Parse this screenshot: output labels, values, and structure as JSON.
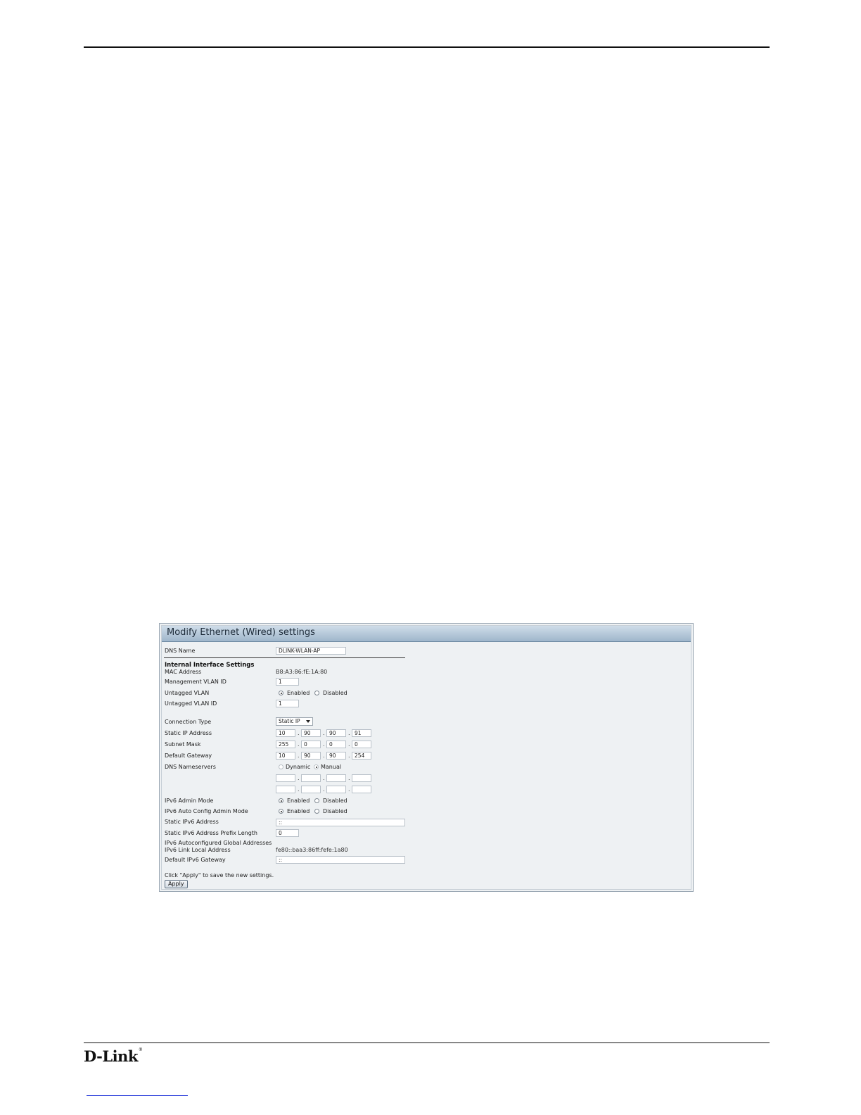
{
  "brand": {
    "name": "D-Link",
    "mark": "®"
  },
  "panel": {
    "title": "Modify Ethernet (Wired) settings",
    "dns_name": {
      "label": "DNS Name",
      "value": "DLINK-WLAN-AP"
    },
    "section_heading": "Internal Interface Settings",
    "mac": {
      "label": "MAC Address",
      "value": "B8:A3:86:fE:1A:80"
    },
    "mgmt_vlan": {
      "label": "Management VLAN ID",
      "value": "1"
    },
    "untagged_vlan": {
      "label": "Untagged VLAN",
      "option_enabled": "Enabled",
      "option_disabled": "Disabled",
      "selected": "Enabled"
    },
    "untagged_vlan_id": {
      "label": "Untagged VLAN ID",
      "value": "1"
    },
    "connection_type": {
      "label": "Connection Type",
      "value": "Static IP"
    },
    "static_ip": {
      "label": "Static IP Address",
      "octets": [
        "10",
        "90",
        "90",
        "91"
      ]
    },
    "subnet_mask": {
      "label": "Subnet Mask",
      "octets": [
        "255",
        "0",
        "0",
        "0"
      ]
    },
    "default_gateway": {
      "label": "Default Gateway",
      "octets": [
        "10",
        "90",
        "90",
        "254"
      ]
    },
    "dns_nameservers": {
      "label": "DNS Nameservers",
      "option_dynamic": "Dynamic",
      "option_manual": "Manual",
      "selected": "Manual",
      "server1": [
        "",
        "",
        "",
        ""
      ],
      "server2": [
        "",
        "",
        "",
        ""
      ]
    },
    "octet_separator": ".",
    "ipv6_admin_mode": {
      "label": "IPv6 Admin Mode",
      "option_enabled": "Enabled",
      "option_disabled": "Disabled",
      "selected": "Enabled"
    },
    "ipv6_auto_config": {
      "label": "IPv6 Auto Config Admin Mode",
      "option_enabled": "Enabled",
      "option_disabled": "Disabled",
      "selected": "Enabled"
    },
    "static_ipv6": {
      "label": "Static IPv6 Address",
      "value": "::"
    },
    "static_ipv6_prefix": {
      "label": "Static IPv6 Address Prefix Length",
      "value": "0"
    },
    "ipv6_global": {
      "label": "IPv6 Autoconfigured Global Addresses"
    },
    "ipv6_link_local": {
      "label": "IPv6 Link Local Address",
      "value": "fe80::baa3:86ff:fefe:1a80"
    },
    "default_ipv6_gateway": {
      "label": "Default IPv6 Gateway",
      "value": "::"
    },
    "hint": "Click \"Apply\" to save the new settings.",
    "apply_label": "Apply"
  }
}
